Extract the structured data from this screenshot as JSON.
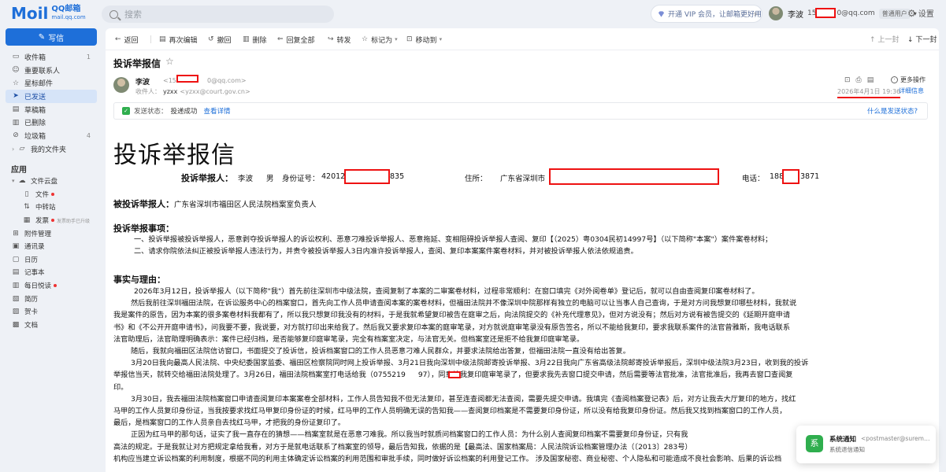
{
  "brand": {
    "logo_mail": "M",
    "logo_mail_rest": "il",
    "logo_qq": "QQ邮箱",
    "logo_url": "mail.qq.com",
    "accent": "#1e6fd9"
  },
  "search": {
    "placeholder": "搜索"
  },
  "header": {
    "vip_text": "开通 VIP 会员，让邮箱更好用",
    "user_name": "李波",
    "user_mail_prefix": "15",
    "user_mail_suffix": "0@qq.com",
    "user_badge": "普通用户",
    "settings": "设置"
  },
  "sidebar": {
    "compose": "写信",
    "items": [
      {
        "label": "收件箱",
        "icon": "inbox-icon",
        "count": "1"
      },
      {
        "label": "重要联系人",
        "icon": "contact-icon",
        "count": ""
      },
      {
        "label": "星标邮件",
        "icon": "star-icon",
        "count": ""
      },
      {
        "label": "已发送",
        "icon": "send-icon",
        "count": "",
        "active": true
      },
      {
        "label": "草稿箱",
        "icon": "draft-icon",
        "count": ""
      },
      {
        "label": "已删除",
        "icon": "trash-icon",
        "count": ""
      },
      {
        "label": "垃圾箱",
        "icon": "spam-icon",
        "count": "4"
      },
      {
        "label": "我的文件夹",
        "icon": "folder-icon",
        "count": ""
      }
    ],
    "apps_title": "应用",
    "apps": [
      {
        "label": "文件云盘",
        "icon": "cloud-icon"
      },
      {
        "label": "文件",
        "icon": "file-icon",
        "dot": true
      },
      {
        "label": "中转站",
        "icon": "transfer-icon"
      },
      {
        "label": "发票",
        "icon": "invoice-icon",
        "dot": true,
        "hint": "发票助手已升级"
      },
      {
        "label": "附件管理",
        "icon": "attachment-icon"
      },
      {
        "label": "通讯录",
        "icon": "addressbook-icon"
      },
      {
        "label": "日历",
        "icon": "calendar-icon"
      },
      {
        "label": "记事本",
        "icon": "notebook-icon"
      },
      {
        "label": "每日悦读",
        "icon": "reading-icon",
        "dot": true
      },
      {
        "label": "简历",
        "icon": "resume-icon"
      },
      {
        "label": "贺卡",
        "icon": "card-icon"
      },
      {
        "label": "文档",
        "icon": "doc-icon"
      }
    ]
  },
  "toolbar": {
    "back": "返回",
    "reedit": "再次编辑",
    "recall": "撤回",
    "delete": "删除",
    "reply_all": "回复全部",
    "forward": "转发",
    "mark_as": "标记为",
    "move_to": "移动到",
    "prev": "上一封",
    "next": "下一封"
  },
  "mail": {
    "subject": "投诉举报信",
    "sender_name": "李波",
    "sender_mail_prefix": "<158",
    "sender_mail_suffix": "0@qq.com>",
    "recv_label": "收件人：",
    "recv_name": "yzxx",
    "recv_mail": "<yzxx@court.gov.cn>",
    "date": "2026年4月1日 19:36",
    "more_ops": "更多操作",
    "detail": "详细信息",
    "status_label": "发送状态：",
    "status_value": "投递成功",
    "status_view": "查看详情",
    "why_slow": "什么是发送状态?"
  },
  "letter": {
    "title": "投诉举报信",
    "complainant_label": "投诉举报人：",
    "complainant_name": "李波",
    "gender": "男",
    "id_label": "身份证号：",
    "id_prefix": "420122",
    "id_suffix": "835",
    "addr_label": "住所：",
    "addr_value": "广东省深圳市",
    "phone_label": "电话：",
    "phone_prefix": "188",
    "phone_suffix": "3871",
    "respondent_label": "被投诉举报人：",
    "respondent_value": "广东省深圳市福田区人民法院档案室负责人",
    "items_title": "投诉举报事项：",
    "items_lines": [
      "一、投诉举报被投诉举报人，恶意剥夺投诉举报人的诉讼权利、恶意刁难投诉举报人、恶意拖延、变相阻碍投诉举报人查阅、复印【（2025）粤0304民初14997号】（以下简称\"本案\"）案件案卷材料；",
      "二、请求你院依法纠正被投诉举报人违法行为，并责令被投诉举报人3日内准许投诉举报人，查阅、复印本案案件案卷材料，并对被投诉举报人依法依规追责。"
    ],
    "facts_title": "事实与理由：",
    "facts_lines": [
      "2026年3月12日，投诉举报人（以下简称\"我\"）首先前往深圳市中级法院，查阅复制了本案的二审案卷材料，过程非常顺利：在窗口填完《对外阅卷单》登记后，就可以自由查阅复印案卷材料了。",
      "然后我前往深圳福田法院，在诉讼服务中心的档案窗口，首先向工作人员申请查阅本案的案卷材料，但福田法院并不像深圳中院那样有独立的电脑可以让当事人自己查询，于是对方问我想复印哪些材料，我就说",
      "我是案件的原告，因为本案的很多案卷材料我都有了，所以我只想复印我没有的材料，于是我就希望复印被告在庭审之后，向法院提交的《补充代理意见》，但对方说没有；然后对方说有被告提交的《延期开庭申请",
      "书》和《不公开开庭申请书》，问我要不要，我说要，对方就打印出来给我了。然后我又要求复印本案的庭审笔录，对方就说庭审笔录没有原告签名，所以不能给我复印，要求我联系案件的法官曾雅斯，我电话联系",
      "法官助理后，法官助理明确表示：案件已经归档，是否能够复印庭审笔录，完全有档案室决定，与法官无关。但档案室还是拒不给我复印庭审笔录。",
      "随后，我就向福田区法院信访窗口，书面提交了投诉信，投诉档案窗口的工作人员恶意刁难人民群众，并要求法院给出答复，但福田法院一直没有给出答复。",
      "3月20日我向最高人民法院、中央纪委国家监委、福田区检察院同时网上投诉举报、3月21日我向深圳中级法院邮寄投诉举报、3月22日我向广东省高级法院邮寄投诉举报后，深圳中级法院3月23日，收到我的投诉",
      "举报信当天，就转交给福田法院处理了。3月26日，福田法院档案室打电话给我（0755219",
      "印。",
      "3月30日，我去福田法院档案窗口申请查阅复印本案案卷全部材料，工作人员告知我不但无法复印，甚至连查阅都无法查阅，需要先提交申请。我填完《查阅档案登记表》后，对方让我去大厅复印的地方，找红",
      "马甲的工作人员复印身份证，当我按要求找红马甲复印身份证的时候，红马甲的工作人员明确无误的告知我——查阅复印档案是不需要复印身份证，所以没有给我复印身份证。然后我又找到档案窗口的工作人员，",
      "最后，是档案窗口的工作人员亲自去找红马甲，才把我的身份证复印了。",
      "正因为红马甲的那句话，证实了我一直存在的猜想——档案室就是在恶意刁难我。所以我当时就质问档案窗口的工作人员：为什么别人查阅复印档案不需要复印身份证，只有我",
      "高法的规定。于是我就让对方把规定拿给我看，对方于是就电话联系了档案室的领导，最后告知我，依据的是【最高法、国家档案局：人民法院诉讼档案管理办法（〔2013〕283号）",
      "机构应当建立诉讼档案的利用制度，根据不同的利用主体确定诉讼档案的利用范围和审批手续，同时做好诉讼档案的利用登记工作。 涉及国家秘密、商业秘密、个人隐私和可能造成不良社会影响、后果的诉讼档"
    ],
    "facts_line8_tail": "97），同意给我复印庭审笔录了，但要求我先去窗口提交申请，然后需要等法官批准，法官批准后，我再去窗口查阅复"
  },
  "notification": {
    "title": "系统通知",
    "from": "<postmaster@suremai...",
    "desc": "系统退信通知"
  }
}
